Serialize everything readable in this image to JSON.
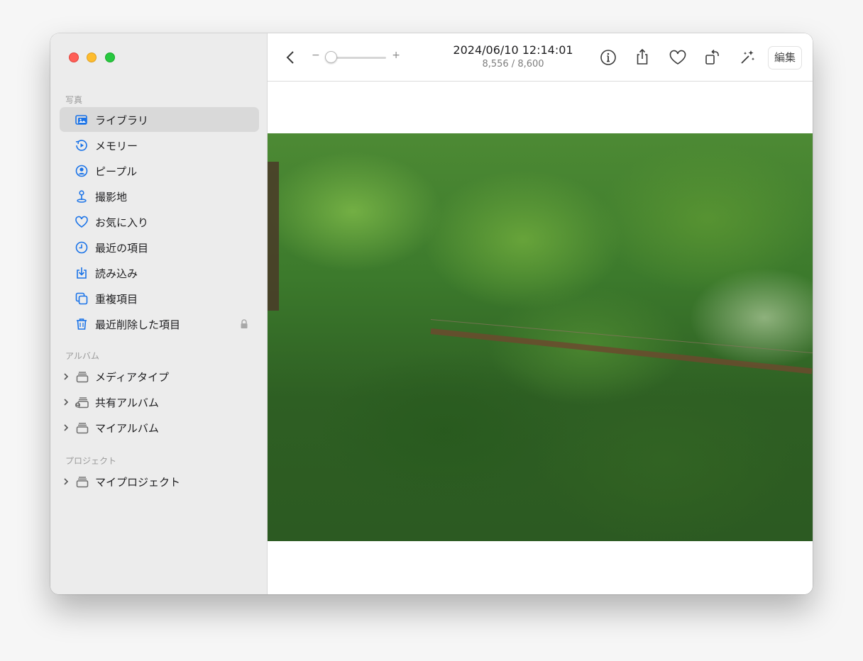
{
  "sidebar": {
    "sections": {
      "photos": "写真",
      "albums": "アルバム",
      "projects": "プロジェクト"
    },
    "items": [
      {
        "label": "ライブラリ",
        "icon": "library-icon",
        "selected": true
      },
      {
        "label": "メモリー",
        "icon": "memories-icon"
      },
      {
        "label": "ピープル",
        "icon": "people-icon"
      },
      {
        "label": "撮影地",
        "icon": "places-icon"
      },
      {
        "label": "お気に入り",
        "icon": "heart-icon"
      },
      {
        "label": "最近の項目",
        "icon": "clock-icon"
      },
      {
        "label": "読み込み",
        "icon": "import-icon"
      },
      {
        "label": "重複項目",
        "icon": "duplicates-icon"
      },
      {
        "label": "最近削除した項目",
        "icon": "trash-icon",
        "locked": true
      }
    ],
    "album_groups": [
      {
        "label": "メディアタイプ",
        "icon": "album-stack-icon"
      },
      {
        "label": "共有アルバム",
        "icon": "shared-album-icon"
      },
      {
        "label": "マイアルバム",
        "icon": "album-stack-icon"
      }
    ],
    "project_groups": [
      {
        "label": "マイプロジェクト",
        "icon": "album-stack-icon"
      }
    ]
  },
  "toolbar": {
    "date": "2024/06/10 12:14:01",
    "count": "8,556 / 8,600",
    "zoom_minus": "−",
    "zoom_plus": "+",
    "zoom_level": 0,
    "edit_label": "編集",
    "icons": [
      "back-icon",
      "info-icon",
      "share-icon",
      "favorite-icon",
      "rotate-icon",
      "enhance-icon"
    ]
  },
  "colors": {
    "accent": "#1a73e8",
    "sidebar_bg": "#ececec",
    "selected_bg": "#d9d9d9"
  }
}
